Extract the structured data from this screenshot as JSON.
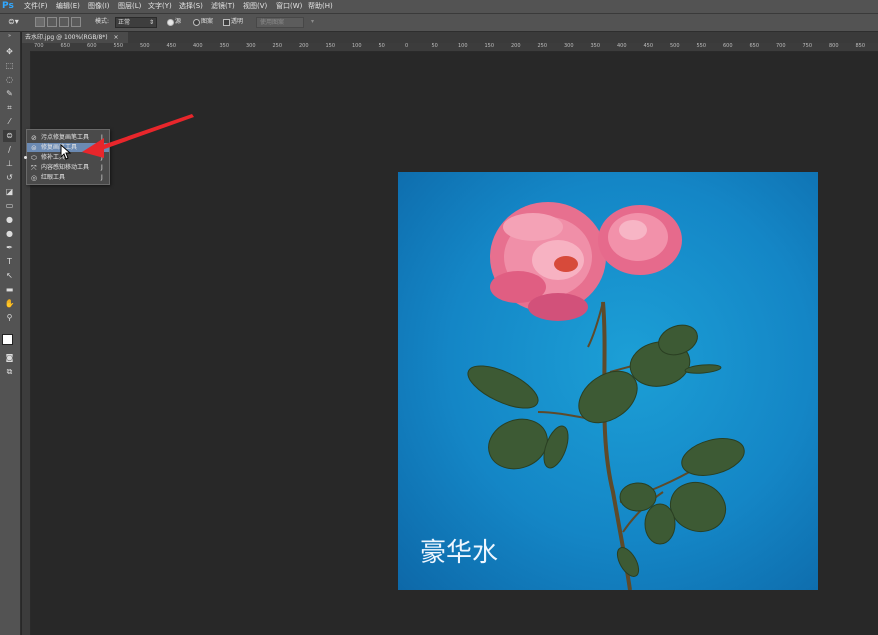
{
  "app": {
    "logo": "Ps"
  },
  "menu": [
    "文件(F)",
    "编辑(E)",
    "图像(I)",
    "图层(L)",
    "文字(Y)",
    "选择(S)",
    "滤镜(T)",
    "视图(V)",
    "窗口(W)",
    "帮助(H)"
  ],
  "options": {
    "mode_label": "模式:",
    "mode_value": "正常",
    "source_label": "源",
    "pattern_label": "图案",
    "transparent_label": "透明",
    "use_pattern_button": "使用图案"
  },
  "document_tab": {
    "title": "去水印.jpg @ 100%(RGB/8*)",
    "close": "×"
  },
  "ruler_labels": [
    "700",
    "650",
    "600",
    "550",
    "500",
    "450",
    "400",
    "350",
    "300",
    "250",
    "200",
    "150",
    "100",
    "50",
    "0",
    "50",
    "100",
    "150",
    "200",
    "250",
    "300",
    "350",
    "400",
    "450",
    "500",
    "550",
    "600",
    "650",
    "700",
    "750",
    "800",
    "850"
  ],
  "tool_flyout": [
    {
      "icon": "spot-healing-brush-icon",
      "label": "污点修复画笔工具",
      "shortcut": "J",
      "selected": false,
      "active": false
    },
    {
      "icon": "healing-brush-icon",
      "label": "修复画笔工具",
      "shortcut": "J",
      "selected": true,
      "active": false
    },
    {
      "icon": "patch-icon",
      "label": "修补工具",
      "shortcut": "J",
      "selected": false,
      "active": true
    },
    {
      "icon": "content-aware-move-icon",
      "label": "内容感知移动工具",
      "shortcut": "J",
      "selected": false,
      "active": false
    },
    {
      "icon": "red-eye-icon",
      "label": "红眼工具",
      "shortcut": "J",
      "selected": false,
      "active": false
    }
  ],
  "canvas": {
    "caption": "豪华水"
  },
  "colors": {
    "accent_arrow": "#e8262b",
    "menu_bg": "#535353",
    "workspace_bg": "#282828",
    "selection": "#6b8ab3",
    "photo_bg": "#1486c6"
  }
}
